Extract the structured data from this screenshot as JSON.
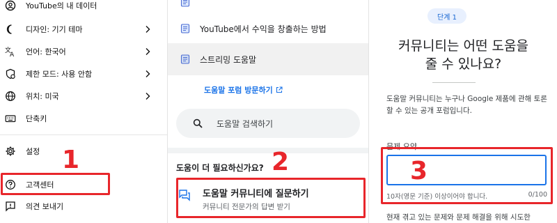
{
  "menu": {
    "items": [
      {
        "icon": "account-data-icon",
        "label": "YouTube의 내 데이터"
      },
      {
        "icon": "moon-icon",
        "label": "디자인: 기기 테마"
      },
      {
        "icon": "translate-icon",
        "label": "언어: 한국어"
      },
      {
        "icon": "restricted-mode-icon",
        "label": "제한 모드: 사용 안함"
      },
      {
        "icon": "globe-icon",
        "label": "위치: 미국"
      },
      {
        "icon": "keyboard-icon",
        "label": "단축키"
      },
      {
        "icon": "gear-icon",
        "label": "설정"
      },
      {
        "icon": "help-icon",
        "label": "고객센터"
      },
      {
        "icon": "feedback-icon",
        "label": "의견 보내기"
      }
    ]
  },
  "help_center": {
    "articles": [
      {
        "label": ""
      },
      {
        "label": "YouTube에서 수익을 창출하는 방법"
      },
      {
        "label": "스트리밍 도움말"
      }
    ],
    "forum_link": "도움말 포럼 방문하기",
    "search_placeholder": "도움말 검색하기",
    "need_help": "도움이 더 필요하신가요?",
    "ask_title": "도움말 커뮤니티에 질문하기",
    "ask_subtitle": "커뮤니티 전문가의 답변 받기"
  },
  "question_form": {
    "step_badge": "단계 1",
    "heading_line1": "커뮤니티는 어떤 도움을",
    "heading_line2": "줄 수 있나요?",
    "description": "도움말 커뮤니티는 누구나 Google 제품에 관해 토론할 수 있는 공개 포럼입니다.",
    "summary_label": "문제 요약",
    "summary_value": "",
    "hint": "10자(영문 기준) 이상이어야 합니다.",
    "char_count": "0/100",
    "bottom_text": "현재 겪고 있는 문제와 문제 해결을 위해 시도한"
  },
  "annotations": {
    "step1": "1",
    "step2": "2",
    "step3": "3",
    "color": "#e8262b"
  },
  "colors": {
    "link_blue": "#1a73e8",
    "badge_bg": "#e8f0fe",
    "selected_row": "#f1f1f1"
  }
}
